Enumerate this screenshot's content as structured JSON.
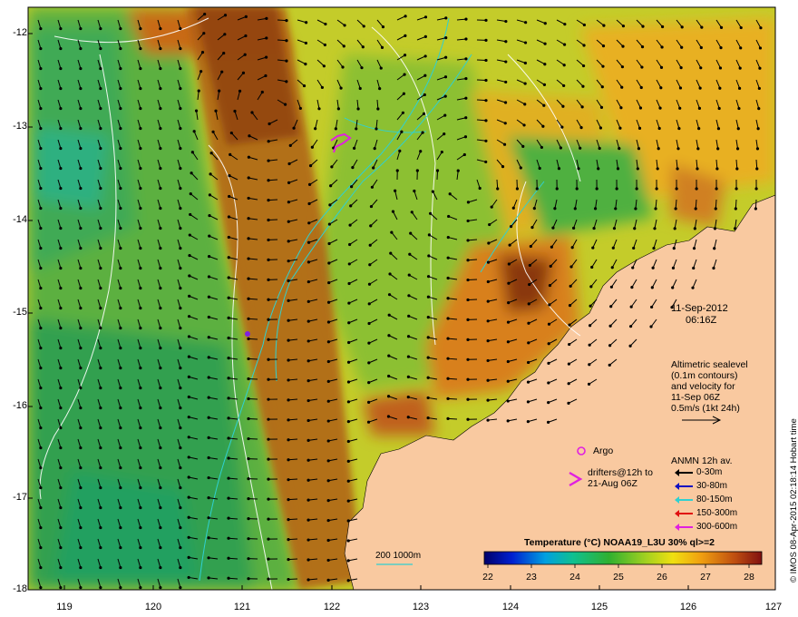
{
  "map": {
    "lat_ticks": [
      "-12",
      "-13",
      "-14",
      "-15",
      "-16",
      "-17",
      "-18"
    ],
    "lon_ticks": [
      "119",
      "120",
      "121",
      "122",
      "123",
      "124",
      "125",
      "126",
      "127"
    ],
    "land_color": "#f9c9a0",
    "scale_bar_label": "200  1000m"
  },
  "info": {
    "date": "11-Sep-2012",
    "time": "06:16Z",
    "altimetry_lines": [
      "Altimetric sealevel",
      "(0.1m contours)",
      "and velocity for",
      "11-Sep 06Z",
      "0.5m/s (1kt 24h)"
    ]
  },
  "legend": {
    "argo_label": "Argo",
    "drifters_lines": [
      "drifters@12h to",
      "21-Aug 06Z"
    ],
    "anmn_title": "ANMN 12h av.",
    "anmn_items": [
      {
        "label": "0-30m",
        "color": "#000000"
      },
      {
        "label": "30-80m",
        "color": "#1010c0"
      },
      {
        "label": "80-150m",
        "color": "#30d0d0"
      },
      {
        "label": "150-300m",
        "color": "#e01010"
      },
      {
        "label": "300-600m",
        "color": "#e020e0"
      }
    ]
  },
  "colorbar": {
    "title": "Temperature (°C) NOAA19_L3U 30% ql>=2",
    "ticks": [
      "22",
      "23",
      "24",
      "25",
      "26",
      "27",
      "28"
    ]
  },
  "credit": "© IMOS 08-Apr-2015 02:18:14 Hobart time"
}
